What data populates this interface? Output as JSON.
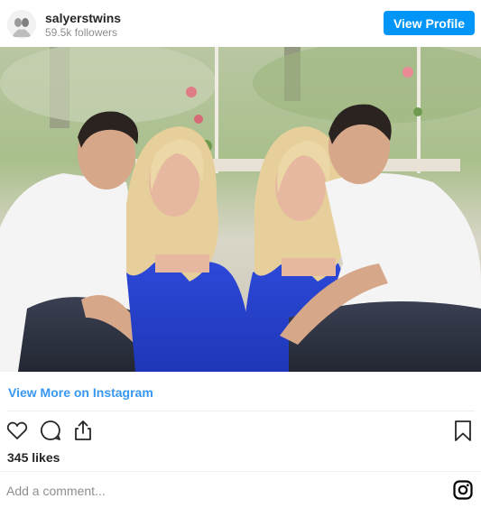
{
  "header": {
    "username": "salyerstwins",
    "followers": "59.5k followers",
    "view_profile_label": "View Profile"
  },
  "post": {
    "view_more_label": "View More on Instagram",
    "likes": "345 likes",
    "comment_placeholder": "Add a comment..."
  },
  "icons": {
    "like": "heart-icon",
    "comment": "comment-icon",
    "share": "share-icon",
    "save": "bookmark-icon",
    "brand": "instagram-icon"
  },
  "colors": {
    "accent": "#0095f6",
    "link": "#3897f0",
    "text": "#262626",
    "muted": "#8e8e8e"
  }
}
